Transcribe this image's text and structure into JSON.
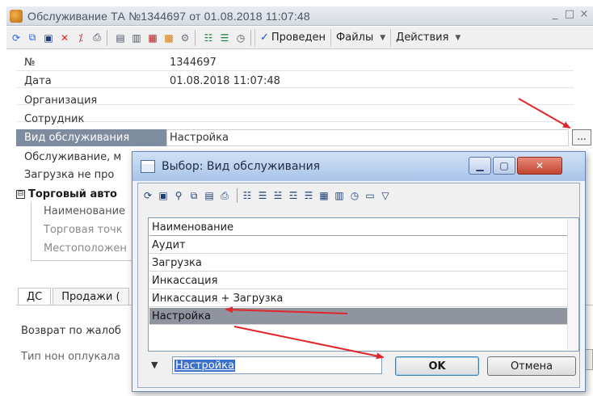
{
  "main_window": {
    "title": "Обслуживание ТА №1344697 от 01.08.2018 11:07:48",
    "controls": [
      "_",
      "□",
      "×"
    ]
  },
  "toolbar": {
    "posted_label": "Проведен",
    "files_label": "Файлы",
    "actions_label": "Действия"
  },
  "form": {
    "rows": [
      {
        "label": "№",
        "value": "1344697"
      },
      {
        "label": "Дата",
        "value": "01.08.2018 11:07:48"
      },
      {
        "label": "Организация",
        "value": ""
      },
      {
        "label": "Сотрудник",
        "value": ""
      },
      {
        "label": "Вид обслуживания",
        "value": "Настройка"
      },
      {
        "label": "Обслуживание, м",
        "value": ""
      },
      {
        "label": "Загрузка не про",
        "value": ""
      }
    ],
    "section_title": "Торговый авто",
    "section_toggle": "⊟",
    "section_items": [
      "Наименование",
      "Торговая точк",
      "Местоположен"
    ],
    "select_button": "..."
  },
  "tabs": [
    "ДС",
    "Продажи ("
  ],
  "tab_panel": {
    "line1": "Возврат по жалоб",
    "line2": "Тип нон оплукала"
  },
  "dialog": {
    "title": "Выбор: Вид обслуживания",
    "list_header": "Наименование",
    "items": [
      "Аудит",
      "Загрузка",
      "Инкассация",
      "Инкассация + Загрузка",
      "Настройка"
    ],
    "selected_index": 4,
    "filter_value": "Настройка",
    "ok_label": "OK",
    "cancel_label": "Отмена"
  },
  "colors": {
    "annotation_arrow": "#e0262b",
    "selection_row": "#8f949e",
    "label_highlight": "#7e8ca0"
  }
}
